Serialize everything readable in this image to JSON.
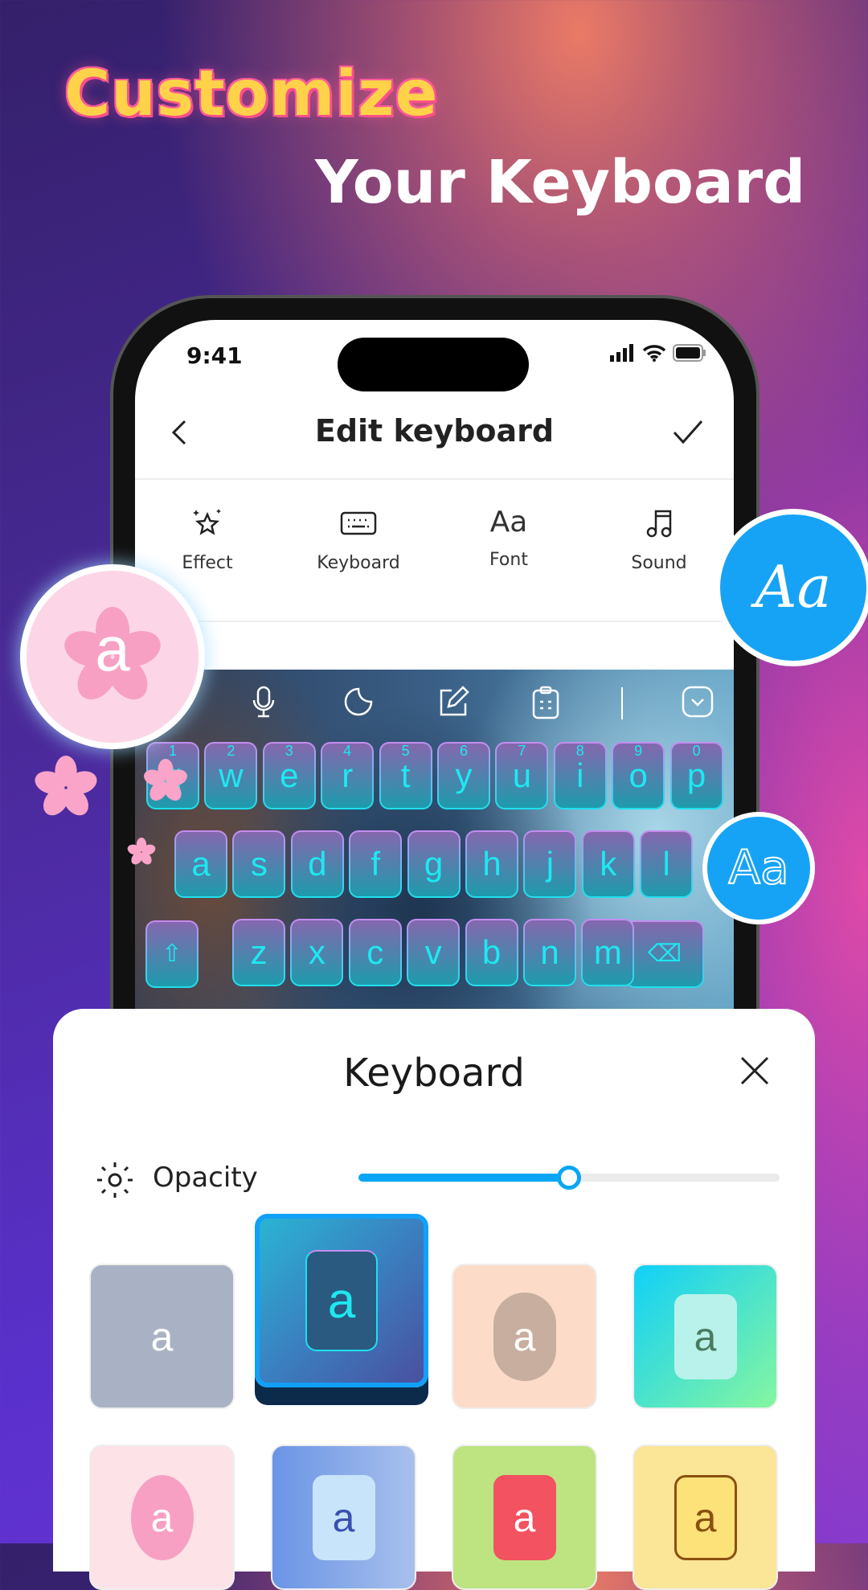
{
  "promo": {
    "title_line1": "Customize",
    "title_line2": "Your Keyboard"
  },
  "status_bar": {
    "time": "9:41"
  },
  "header": {
    "title": "Edit keyboard",
    "back_icon": "chevron-left-icon",
    "confirm_icon": "check-icon"
  },
  "tabs": [
    {
      "label": "Effect",
      "icon": "sparkle-star-icon"
    },
    {
      "label": "Keyboard",
      "icon": "keyboard-icon"
    },
    {
      "label": "Font",
      "icon": "font-icon",
      "glyph": "Aa"
    },
    {
      "label": "Sound",
      "icon": "music-note-icon"
    }
  ],
  "keyboard_toolbar": [
    "microphone-icon",
    "sticker-icon",
    "edit-icon",
    "clipboard-icon",
    "collapse-keyboard-icon"
  ],
  "keys": {
    "row1": [
      {
        "k": "q",
        "n": "1"
      },
      {
        "k": "w",
        "n": "2"
      },
      {
        "k": "e",
        "n": "3"
      },
      {
        "k": "r",
        "n": "4"
      },
      {
        "k": "t",
        "n": "5"
      },
      {
        "k": "y",
        "n": "6"
      },
      {
        "k": "u",
        "n": "7"
      },
      {
        "k": "i",
        "n": "8"
      },
      {
        "k": "o",
        "n": "9"
      },
      {
        "k": "p",
        "n": "0"
      }
    ],
    "row2": [
      "a",
      "s",
      "d",
      "f",
      "g",
      "h",
      "j",
      "k",
      "l"
    ],
    "row3": [
      "z",
      "x",
      "c",
      "v",
      "b",
      "n",
      "m"
    ]
  },
  "badges": {
    "left_letter": "a",
    "right_script": "Aa",
    "right_outline": "Aa"
  },
  "sheet": {
    "title": "Keyboard",
    "close_icon": "close-icon",
    "opacity": {
      "label": "Opacity",
      "icon": "brightness-icon",
      "value": 0.5,
      "accent": "#0aa6f5"
    },
    "styles": [
      {
        "letter": "a",
        "bg": "#a8b2c4",
        "selected": false
      },
      {
        "letter": "a",
        "bg": "#3a8ec0",
        "selected": true
      },
      {
        "letter": "a",
        "bg": "#fcdcc8",
        "selected": false
      },
      {
        "letter": "a",
        "bg": "#2cd8e0",
        "selected": false
      },
      {
        "letter": "a",
        "bg": "#fde2e8",
        "selected": false
      },
      {
        "letter": "a",
        "bg": "#7aa0e8",
        "selected": false
      },
      {
        "letter": "a",
        "bg": "#bde480",
        "selected": false
      },
      {
        "letter": "a",
        "bg": "#fbe596",
        "selected": false
      }
    ]
  }
}
